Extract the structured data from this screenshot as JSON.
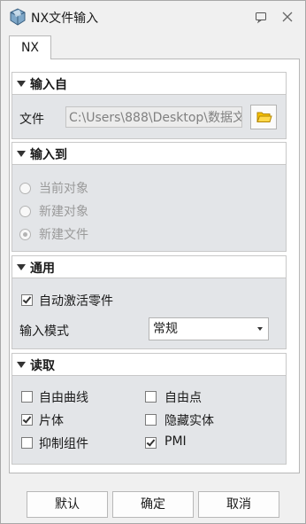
{
  "window": {
    "title": "NX文件输入"
  },
  "tabs": [
    {
      "label": "NX"
    }
  ],
  "groups": {
    "import_from": {
      "title": "输入自",
      "file_label": "文件",
      "file_value": "C:\\Users\\888\\Desktop\\数据文"
    },
    "import_to": {
      "title": "输入到",
      "options": [
        {
          "label": "当前对象",
          "selected": false
        },
        {
          "label": "新建对象",
          "selected": false
        },
        {
          "label": "新建文件",
          "selected": true
        }
      ]
    },
    "general": {
      "title": "通用",
      "auto_activate_label": "自动激活零件",
      "auto_activate_checked": true,
      "mode_label": "输入模式",
      "mode_value": "常规"
    },
    "read": {
      "title": "读取",
      "options": [
        {
          "label": "自由曲线",
          "checked": false
        },
        {
          "label": "自由点",
          "checked": false
        },
        {
          "label": "片体",
          "checked": true
        },
        {
          "label": "隐藏实体",
          "checked": false
        },
        {
          "label": "抑制组件",
          "checked": false
        },
        {
          "label": "PMI",
          "checked": true
        }
      ]
    }
  },
  "footer": {
    "default_label": "默认",
    "ok_label": "确定",
    "cancel_label": "取消"
  },
  "colors": {
    "group_body": "#e3e5e8",
    "folder_icon": "#f0b400"
  }
}
